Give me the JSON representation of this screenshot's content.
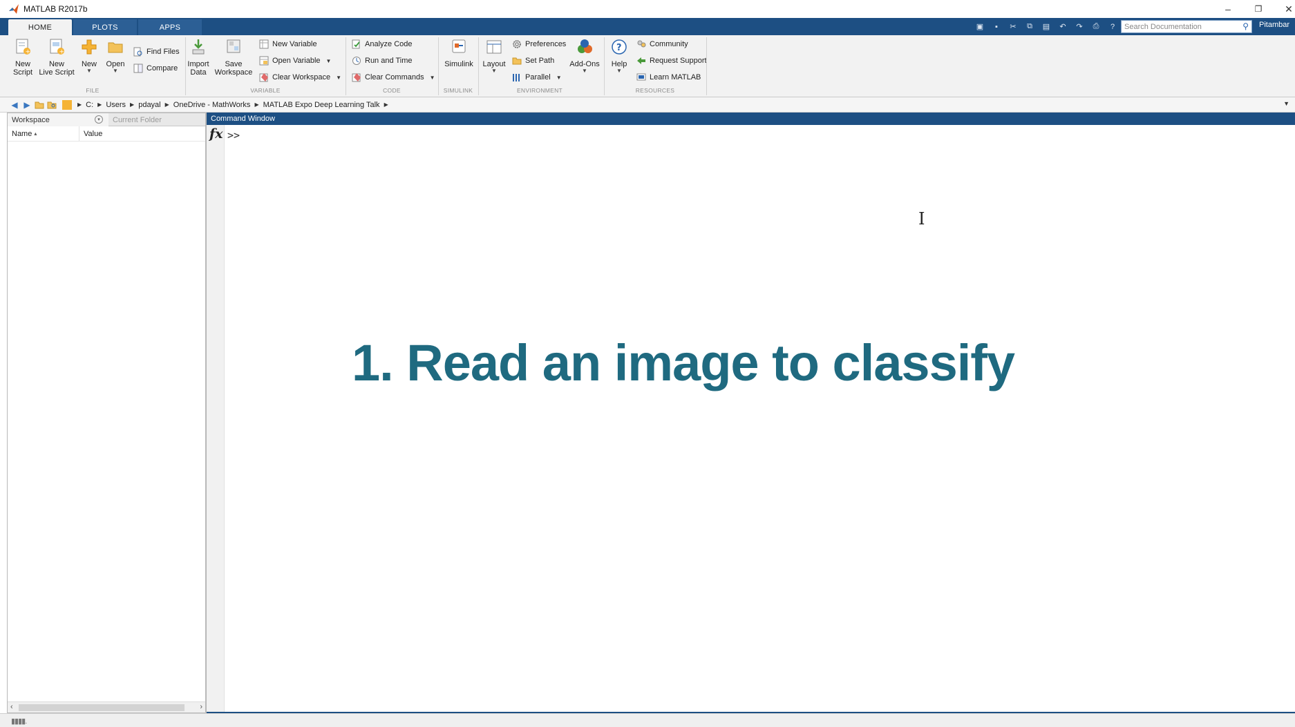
{
  "window": {
    "title": "MATLAB R2017b",
    "controls": {
      "minimize": "–",
      "restore": "❐",
      "close": "✕"
    }
  },
  "tabs": [
    "HOME",
    "PLOTS",
    "APPS"
  ],
  "search": {
    "placeholder": "Search Documentation"
  },
  "user": "Pitambar",
  "ribbon": {
    "file": {
      "label": "FILE",
      "new_script": [
        "New",
        "Script"
      ],
      "new_live_script": [
        "New",
        "Live Script"
      ],
      "new": "New",
      "open": "Open",
      "find_files": "Find Files",
      "compare": "Compare"
    },
    "variable": {
      "label": "VARIABLE",
      "import_data": [
        "Import",
        "Data"
      ],
      "save_workspace": [
        "Save",
        "Workspace"
      ],
      "new_variable": "New Variable",
      "open_variable": "Open Variable",
      "clear_workspace": "Clear Workspace"
    },
    "code": {
      "label": "CODE",
      "analyze_code": "Analyze Code",
      "run_and_time": "Run and Time",
      "clear_commands": "Clear Commands"
    },
    "simulink": {
      "label": "SIMULINK",
      "simulink": "Simulink"
    },
    "environment": {
      "label": "ENVIRONMENT",
      "layout": "Layout",
      "preferences": "Preferences",
      "set_path": "Set Path",
      "parallel": "Parallel",
      "add_ons": "Add-Ons"
    },
    "resources": {
      "label": "RESOURCES",
      "help": "Help",
      "community": "Community",
      "request_support": "Request Support",
      "learn_matlab": "Learn MATLAB"
    }
  },
  "path": [
    "C:",
    "Users",
    "pdayal",
    "OneDrive - MathWorks",
    "MATLAB Expo Deep Learning Talk"
  ],
  "workspace": {
    "tab_active": "Workspace",
    "tab_inactive": "Current Folder",
    "col_name": "Name",
    "col_value": "Value"
  },
  "command_window": {
    "title": "Command Window",
    "fx": "fx",
    "prompt": ">>",
    "overlay_text": "1. Read an image to classify"
  },
  "colors": {
    "accent": "#1d4f83",
    "overlay": "#1f6a80"
  }
}
